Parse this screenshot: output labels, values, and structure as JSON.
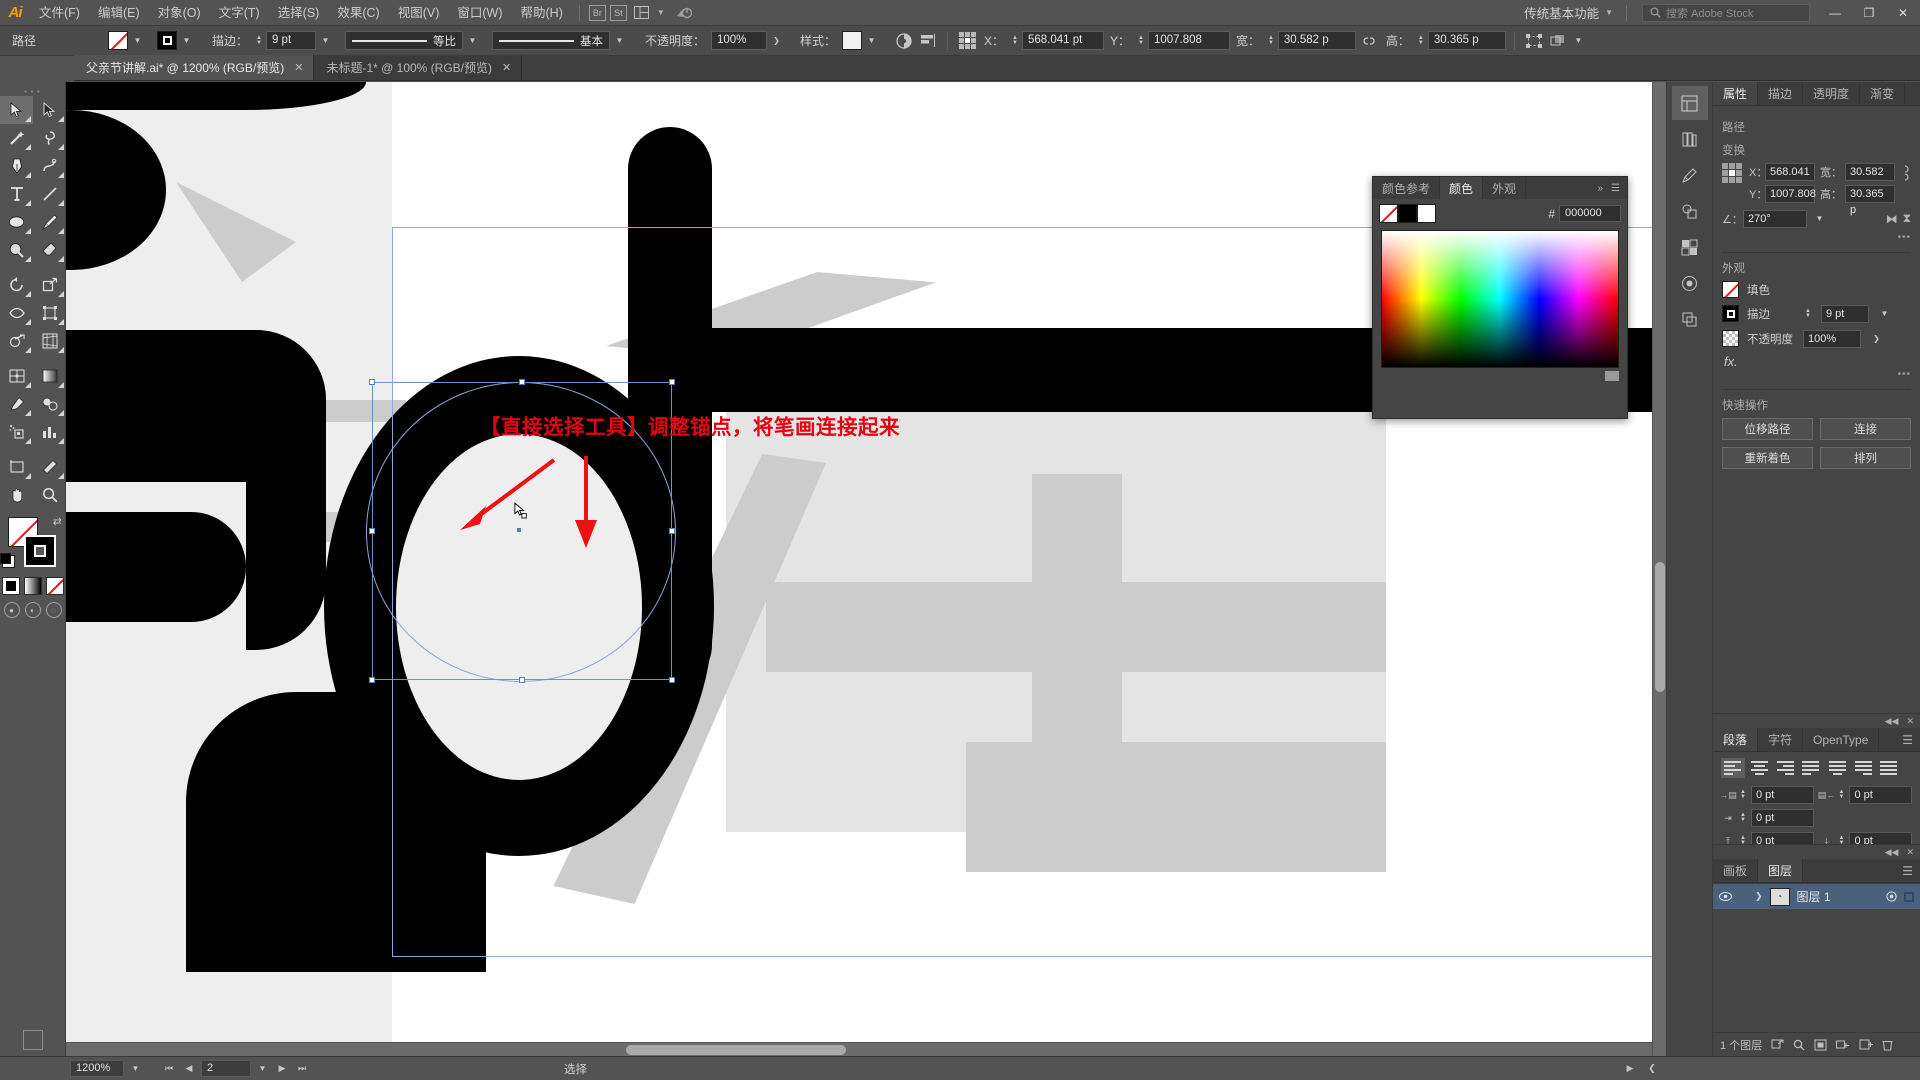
{
  "app": {
    "name": "Adobe Illustrator",
    "logo_text": "Ai",
    "workspace": "传统基本功能",
    "stock_placeholder": "搜索 Adobe Stock"
  },
  "menubar": {
    "items": [
      {
        "label": "文件(F)",
        "name": "menu-file"
      },
      {
        "label": "编辑(E)",
        "name": "menu-edit"
      },
      {
        "label": "对象(O)",
        "name": "menu-object"
      },
      {
        "label": "文字(T)",
        "name": "menu-type"
      },
      {
        "label": "选择(S)",
        "name": "menu-select"
      },
      {
        "label": "效果(C)",
        "name": "menu-effect"
      },
      {
        "label": "视图(V)",
        "name": "menu-view"
      },
      {
        "label": "窗口(W)",
        "name": "menu-window"
      },
      {
        "label": "帮助(H)",
        "name": "menu-help"
      }
    ],
    "icons": [
      "bridge-icon",
      "stock-icon",
      "arrange-documents-icon"
    ],
    "stock_label": "St",
    "window_controls": {
      "minimize": "—",
      "restore": "❐",
      "close": "✕"
    }
  },
  "controlbar": {
    "object_label": "路径",
    "fill_label": "填色",
    "stroke_label": "描边：",
    "stroke_weight": "9 pt",
    "profile_variable": "等比",
    "brush_definition": "基本",
    "opacity_label": "不透明度：",
    "opacity_value": "100%",
    "style_label": "样式：",
    "transform_x_label": "X：",
    "transform_x": "568.041 pt",
    "transform_y_label": "Y：",
    "transform_y": "1007.808",
    "width_label": "宽：",
    "width_value": "30.582 p",
    "height_label": "高：",
    "height_value": "30.365 p",
    "icons": [
      "recolor-artwork-icon",
      "align-icon",
      "reference-point-icon",
      "lock-proportions-icon",
      "transform-icon",
      "arrange-icon"
    ]
  },
  "tabs": [
    {
      "title": "父亲节讲解.ai* @ 1200% (RGB/预览)",
      "active": true,
      "closable": true
    },
    {
      "title": "未标题-1* @ 100% (RGB/预览)",
      "active": false,
      "closable": true
    }
  ],
  "toolbar": {
    "tools": [
      {
        "name": "selection-tool",
        "glyph": "selection",
        "active": true
      },
      {
        "name": "direct-selection-tool",
        "glyph": "direct-selection",
        "active": false
      },
      {
        "name": "magic-wand-tool",
        "glyph": "magic-wand",
        "active": false
      },
      {
        "name": "lasso-tool",
        "glyph": "lasso",
        "active": false
      },
      {
        "name": "pen-tool",
        "glyph": "pen",
        "active": false
      },
      {
        "name": "curvature-tool",
        "glyph": "curvature",
        "active": false
      },
      {
        "name": "type-tool",
        "glyph": "type",
        "active": false
      },
      {
        "name": "line-segment-tool",
        "glyph": "line",
        "active": false
      },
      {
        "name": "ellipse-tool",
        "glyph": "ellipse",
        "active": false
      },
      {
        "name": "paintbrush-tool",
        "glyph": "paintbrush",
        "active": false
      },
      {
        "name": "shaper-tool",
        "glyph": "shaper",
        "active": false
      },
      {
        "name": "eraser-tool",
        "glyph": "eraser",
        "active": false
      },
      {
        "name": "rotate-tool",
        "glyph": "rotate",
        "active": false
      },
      {
        "name": "scale-tool",
        "glyph": "scale",
        "active": false
      },
      {
        "name": "width-tool",
        "glyph": "width",
        "active": false
      },
      {
        "name": "free-transform-tool",
        "glyph": "free-transform",
        "active": false
      },
      {
        "name": "shape-builder-tool",
        "glyph": "shape-builder",
        "active": false
      },
      {
        "name": "perspective-grid-tool",
        "glyph": "perspective-grid",
        "active": false
      },
      {
        "name": "mesh-tool",
        "glyph": "mesh",
        "active": false
      },
      {
        "name": "gradient-tool",
        "glyph": "gradient",
        "active": false
      },
      {
        "name": "eyedropper-tool",
        "glyph": "eyedropper",
        "active": false
      },
      {
        "name": "blend-tool",
        "glyph": "blend",
        "active": false
      },
      {
        "name": "symbol-sprayer-tool",
        "glyph": "symbol-sprayer",
        "active": false
      },
      {
        "name": "column-graph-tool",
        "glyph": "column-graph",
        "active": false
      },
      {
        "name": "artboard-tool",
        "glyph": "artboard",
        "active": false
      },
      {
        "name": "slice-tool",
        "glyph": "slice",
        "active": false
      },
      {
        "name": "hand-tool",
        "glyph": "hand",
        "active": false
      },
      {
        "name": "zoom-tool",
        "glyph": "zoom",
        "active": false
      }
    ],
    "fill_color": "none",
    "stroke_color": "#000000"
  },
  "canvas": {
    "zoom_display": "1200%",
    "annotation": "【直接选择工具】调整锚点，将笔画连接起来",
    "annotation_color": "#e60012",
    "artwork_color": "#000000",
    "shadow_color": "#cccccc",
    "background_color": "#eeeeee",
    "selection_color": "#6f8fd0"
  },
  "color_panel": {
    "tabs": [
      {
        "label": "颜色参考",
        "active": false
      },
      {
        "label": "颜色",
        "active": true
      },
      {
        "label": "外观",
        "active": false
      }
    ],
    "hex_prefix": "#",
    "hex_value": "000000",
    "swatches": [
      "none",
      "#000000",
      "#ffffff"
    ]
  },
  "properties_panel": {
    "tabs": [
      {
        "label": "属性",
        "active": true
      },
      {
        "label": "描边",
        "active": false
      },
      {
        "label": "透明度",
        "active": false
      },
      {
        "label": "渐变",
        "active": false
      }
    ],
    "object_section_title": "路径",
    "transform_title": "变换",
    "x_label": "X：",
    "x_value": "568.041",
    "y_label": "Y：",
    "y_value": "1007.808",
    "w_label": "宽：",
    "w_value": "30.582 p",
    "h_label": "高：",
    "h_value": "30.365 p",
    "angle_label": "∠：",
    "angle_value": "270°",
    "appearance_title": "外观",
    "fill_label": "填色",
    "stroke_label": "描边",
    "stroke_value": "9 pt",
    "opacity_label": "不透明度",
    "opacity_value": "100%",
    "fx_label": "fx.",
    "quick_actions_title": "快速操作",
    "quick_actions": [
      {
        "label": "位移路径",
        "name": "offset-path-button"
      },
      {
        "label": "连接",
        "name": "join-button"
      },
      {
        "label": "重新着色",
        "name": "recolor-button"
      },
      {
        "label": "排列",
        "name": "arrange-button"
      }
    ]
  },
  "paragraph_panel": {
    "tabs": [
      {
        "label": "段落",
        "active": true
      },
      {
        "label": "字符",
        "active": false
      },
      {
        "label": "OpenType",
        "active": false
      }
    ],
    "alignments": [
      {
        "name": "align-left",
        "selected": true
      },
      {
        "name": "align-center",
        "selected": false
      },
      {
        "name": "align-right",
        "selected": false
      },
      {
        "name": "justify-last-left",
        "selected": false
      },
      {
        "name": "justify-last-center",
        "selected": false
      },
      {
        "name": "justify-last-right",
        "selected": false
      },
      {
        "name": "justify-all",
        "selected": false
      }
    ],
    "fields": [
      {
        "name": "indent-left",
        "value": "0 pt"
      },
      {
        "name": "indent-right",
        "value": "0 pt"
      },
      {
        "name": "indent-first-line",
        "value": "0 pt"
      },
      {
        "name": "space-before",
        "value": "0 pt"
      },
      {
        "name": "space-after",
        "value": "0 pt"
      }
    ]
  },
  "layers_panel": {
    "tabs": [
      {
        "label": "画板",
        "active": false
      },
      {
        "label": "图层",
        "active": true
      }
    ],
    "layers": [
      {
        "name": "图层 1",
        "visible": true,
        "locked": false,
        "selected": true
      }
    ],
    "footer_count": "1 个图层",
    "footer_icons": [
      "locate-object-icon",
      "make-clipping-mask-icon",
      "create-sublayer-icon",
      "create-new-layer-icon",
      "delete-selection-icon"
    ]
  },
  "dock_icons": [
    {
      "name": "properties-dock-icon",
      "selected": true
    },
    {
      "name": "libraries-dock-icon",
      "selected": false
    },
    {
      "name": "brushes-dock-icon",
      "selected": false
    },
    {
      "name": "symbols-dock-icon",
      "selected": false
    },
    {
      "name": "swatches-dock-icon",
      "selected": false
    },
    {
      "name": "appearance-dock-icon",
      "selected": false
    },
    {
      "name": "pathfinder-dock-icon",
      "selected": false
    }
  ],
  "statusbar": {
    "zoom_value": "1200%",
    "artboard_number": "2",
    "status_text": "选择",
    "nav_first": "⏮",
    "nav_prev": "◀",
    "nav_next": "▶",
    "nav_last": "⏭"
  }
}
